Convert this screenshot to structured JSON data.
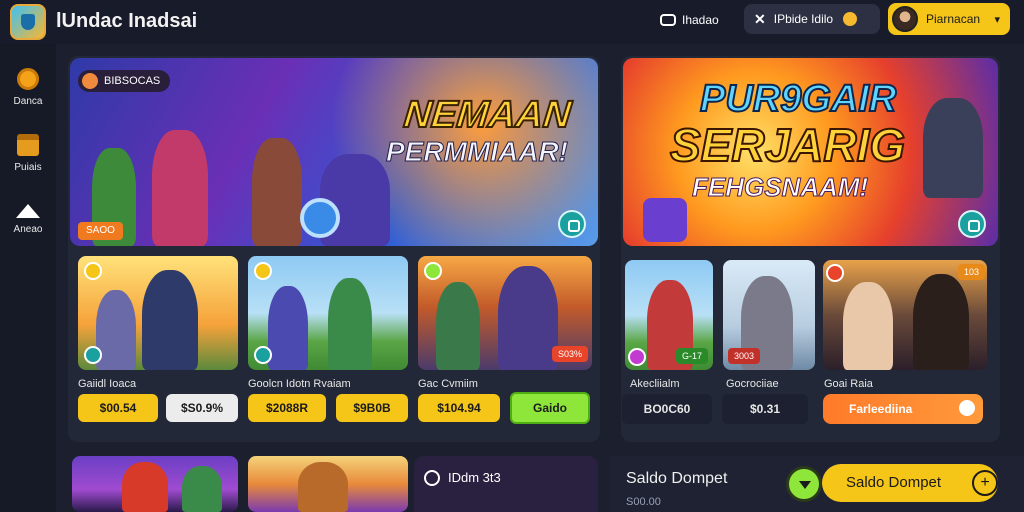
{
  "header": {
    "app_title": "lUndac Inadsai",
    "btn_one": "Ihadao",
    "btn_two": "IPbide Idilo",
    "profile_name": "Piarnacan",
    "chevron": "▾"
  },
  "sidebar": {
    "items": [
      {
        "label": "Danca",
        "icon": "home-coin-icon"
      },
      {
        "label": "Puiais",
        "icon": "treasure-chest-icon"
      },
      {
        "label": "Aneao",
        "icon": "graduation-cap-icon"
      }
    ]
  },
  "hero_left": {
    "badge": "BIBSOCAS",
    "title": "NEMAAN",
    "subtitle": "PERMMIAAR!",
    "tag": "SAOO"
  },
  "hero_right": {
    "line1": "PUR9GAIR",
    "line2": "SERJARIG",
    "line3": "FEHGSNAAM!"
  },
  "cards_left": [
    {
      "title": "Gaiidl Ioaca",
      "prices": [
        "$00.54",
        "$S0.9%"
      ]
    },
    {
      "title": "Goolcn Idotn Rvaiam",
      "prices": [
        "$2088R",
        "$9B0B"
      ]
    },
    {
      "title": "Gac Cvmiim",
      "prices": [
        "$104.94",
        "Gaido"
      ],
      "tag": "S03%"
    }
  ],
  "cards_right": [
    {
      "title": "Akecliialm",
      "tag": "G-17",
      "price": "BO0C60"
    },
    {
      "title": "Gocrociiae",
      "tag": "3003",
      "price": "$0.31"
    },
    {
      "title": "Goai Raia",
      "tag": "103",
      "price": "Farleediina"
    }
  ],
  "bottom": {
    "dark_label": "IDdm 3t3",
    "wallet_title": "Saldo Dompet",
    "wallet_sub": "S00.00",
    "wallet_button": "Saldo Dompet",
    "plus": "+"
  }
}
